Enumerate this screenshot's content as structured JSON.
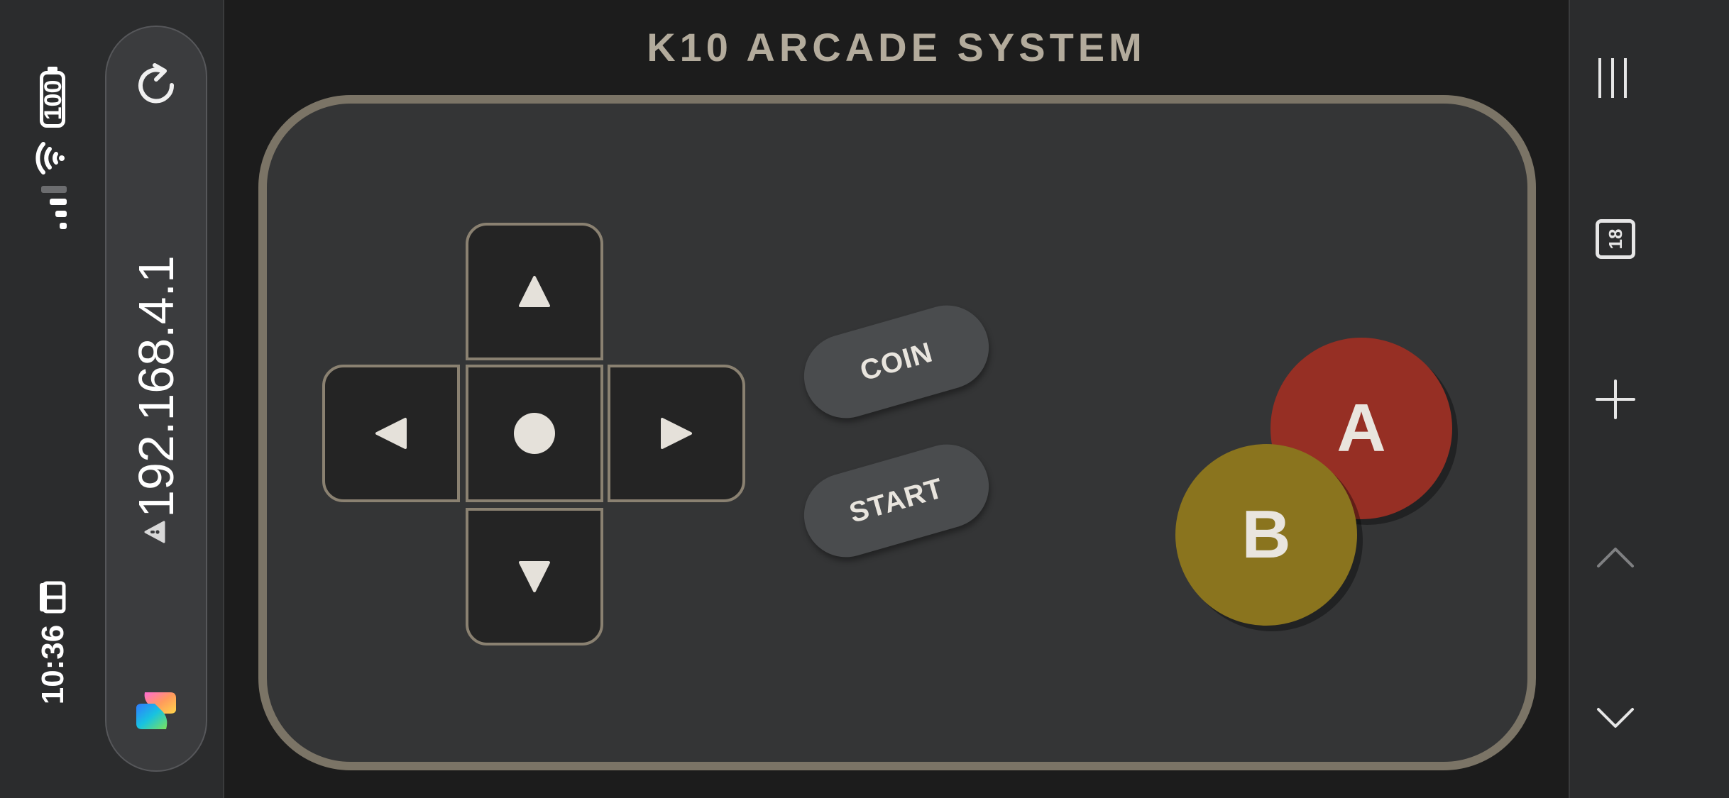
{
  "status_bar": {
    "battery": "100",
    "time": "10:36",
    "wifi_icon": "wifi-icon",
    "signal_icon": "signal-bars-icon",
    "tab_icon": "tab-icon"
  },
  "address_pill": {
    "url": "192.168.4.1",
    "reload_icon": "reload-icon",
    "insecure_icon": "warning-icon",
    "app_icon": "app-logo-icon"
  },
  "right_toolbar": {
    "tab_count": "18",
    "items": [
      "menu-icon",
      "tabs-icon",
      "plus-icon",
      "chevron-up-icon",
      "chevron-down-icon"
    ]
  },
  "page": {
    "title": "K10 ARCADE SYSTEM"
  },
  "controls": {
    "coin_label": "COIN",
    "start_label": "START",
    "a_label": "A",
    "b_label": "B",
    "dpad": [
      "up-arrow-icon",
      "left-arrow-icon",
      "center-dot-icon",
      "right-arrow-icon",
      "down-arrow-icon"
    ]
  },
  "colors": {
    "a_button": "#962f24",
    "b_button": "#8a741e",
    "frame": "#7b7466",
    "title": "#b3ab9c"
  }
}
